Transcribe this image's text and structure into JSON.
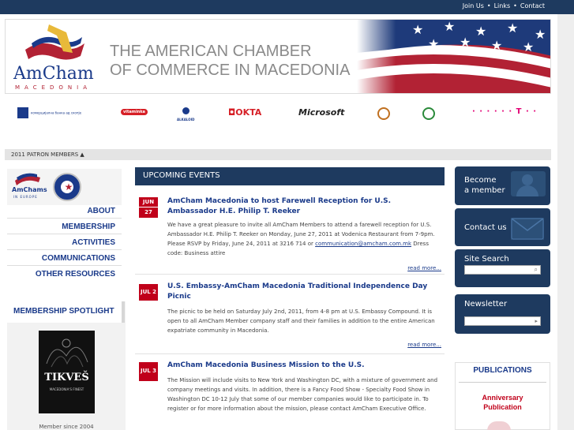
{
  "top_links": [
    "Join Us",
    "Links",
    "Contact"
  ],
  "banner": {
    "logo_text": "AmCham",
    "logo_sub": "MACEDONIA",
    "title_line1": "THE AMERICAN CHAMBER",
    "title_line2": "OF COMMERCE IN MACEDONIA"
  },
  "sponsors": [
    {
      "name": "комерцијална банка ад скопје",
      "color": "#1a3a8a"
    },
    {
      "name": "vitaminka",
      "color": "#d61f26"
    },
    {
      "name": "ALKALOID",
      "color": "#1a3a8a"
    },
    {
      "name": "OKTA",
      "color": "#d61f26"
    },
    {
      "name": "Microsoft",
      "color": "#222222"
    },
    {
      "name": "emblem",
      "color": "#c07020"
    },
    {
      "name": "emblem",
      "color": "#2a8a3a"
    },
    {
      "name": "· · · · · · T · ·",
      "color": "#e20074"
    }
  ],
  "patron_bar": "2011 PATRON MEMBERS ▲",
  "left_logo": {
    "text": "AmChams",
    "sub": "IN EUROPE"
  },
  "nav": [
    "ABOUT",
    "MEMBERSHIP",
    "ACTIVITIES",
    "COMMUNICATIONS",
    "OTHER RESOURCES"
  ],
  "spotlight": {
    "title": "MEMBERSHIP  SPOTLIGHT",
    "brand": "TIKVEŠ",
    "brand_sub": "MACEDONIA'S FINEST",
    "member_since": "Member since 2004"
  },
  "events_header": "UPCOMING EVENTS",
  "events": [
    {
      "month": "JUN",
      "day": "27",
      "title": "AmCham Macedonia to host Farewell Reception for U.S. Ambassador H.E. Philip T. Reeker",
      "text": "We have a great pleasure to invite all AmCham Members to attend a farewell reception for U.S. Ambassador H.E. Philip T. Reeker on Monday, June 27, 2011 at Vodenica Restaurant from 7-9pm. Please RSVP by Friday, June 24, 2011 at 3216 714 or",
      "email": "communication@amcham.com.mk",
      "text_after": " Dress code: Business attire",
      "read_more": "read more..."
    },
    {
      "month": "JUL 2",
      "day": "",
      "title": "U.S. Embassy-AmCham Macedonia Traditional Independence Day Picnic",
      "text": "The picnic to be held on Saturday July 2nd, 2011, from 4-8 pm at U.S. Embassy Compound. It is  open to all AmCham Member company staff and their families in addition to the entire American expatriate community in Macedonia.",
      "read_more": "read more..."
    },
    {
      "month": "JUL 3",
      "day": "",
      "title": "AmCham Macedonia Business Mission to the U.S.",
      "text": "The Mission will include visits to New York and Washington DC, with a mixture of government and company meetings and visits.  In addition, there is a Fancy Food Show - Specialty Food Show in Washington DC 10-12 July that some of our member companies would like to participate in. To register or for more information about the mission, please contact AmCham Executive Office."
    }
  ],
  "right": {
    "become_member": [
      "Become",
      "a member"
    ],
    "contact": "Contact us",
    "site_search": "Site Search",
    "newsletter": "Newsletter",
    "publications": "PUBLICATIONS",
    "anniversary": [
      "Anniversary",
      "Publication"
    ]
  },
  "colors": {
    "navy": "#1e3a5f",
    "red": "#c0001a",
    "link": "#1a3a8a"
  }
}
